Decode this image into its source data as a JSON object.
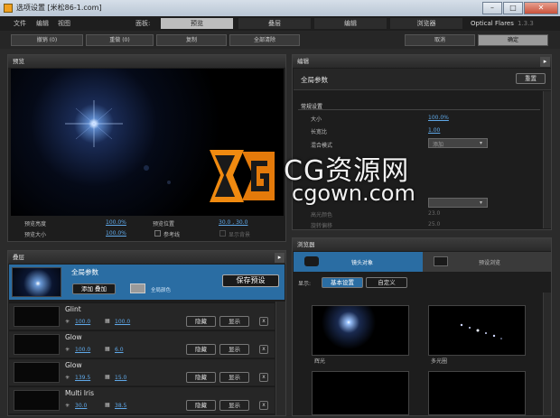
{
  "window": {
    "title": "选项设置 [米松86-1.com]",
    "minimize": "–",
    "maximize": "□",
    "close": "✕"
  },
  "menu": {
    "file": "文件",
    "edit": "编辑",
    "view": "视图",
    "panel_label": "面板:"
  },
  "panel_tabs": [
    {
      "label": "预览"
    },
    {
      "label": "叠层"
    },
    {
      "label": "编辑"
    },
    {
      "label": "浏览器"
    }
  ],
  "brand": {
    "name": "Optical Flares",
    "version": "1.3.3"
  },
  "toolbar": {
    "undo": "撤销 (0)",
    "redo": "重做 (0)",
    "copy": "复制",
    "clear_all": "全部清除",
    "cancel": "取消",
    "ok": "确定"
  },
  "preview": {
    "title": "预览",
    "brightness_label": "预览亮度",
    "brightness_value": "100.0%",
    "position_label": "预览位置",
    "position_value": "30.0 , 30.0",
    "size_label": "预览大小",
    "size_value": "100.0%",
    "reference_label": "参考线",
    "show_bg_label": "显示背景"
  },
  "layers": {
    "title": "叠层",
    "global": {
      "name": "全局参数",
      "add_label": "添加 叠加",
      "color_label": "全局颜色",
      "save_preset": "保存预设"
    },
    "items": [
      {
        "name": "Glint",
        "brightness": "100.0",
        "scale": "100.0",
        "hide": "隐藏",
        "show": "显示",
        "close": "x"
      },
      {
        "name": "Glow",
        "brightness": "100.0",
        "scale": "6.0",
        "hide": "隐藏",
        "show": "显示",
        "close": "x"
      },
      {
        "name": "Glow",
        "brightness": "139.5",
        "scale": "15.0",
        "hide": "隐藏",
        "show": "显示",
        "close": "x"
      },
      {
        "name": "Multi Iris",
        "brightness": "30.0",
        "scale": "38.5",
        "hide": "隐藏",
        "show": "显示",
        "close": "x"
      }
    ]
  },
  "editor": {
    "title": "编辑",
    "global_label": "全局参数",
    "reset": "重置",
    "section": "常规设置",
    "rows": [
      {
        "label": "大小",
        "value": "100.0%"
      },
      {
        "label": "长宽比",
        "value": "1.00"
      },
      {
        "label": "混合模式",
        "value": "添加"
      }
    ],
    "faded": [
      {
        "label": "高光颜色",
        "value": "23.0"
      },
      {
        "label": "旋转偏移",
        "value": "25.0"
      }
    ]
  },
  "browser": {
    "title": "浏览器",
    "tab_lens": "镜头对象",
    "tab_presets": "预设浏览",
    "show_label": "显示:",
    "filter_basic": "基本设置",
    "filter_custom": "自定义",
    "thumbs": [
      {
        "label": "辉光"
      },
      {
        "label": "多光圈"
      }
    ]
  },
  "watermark": {
    "line1": "CG资源网",
    "line2": "cgown.com"
  },
  "colors": {
    "accent": "#2a6da3",
    "value_blue": "#5fa8e8",
    "logo_orange": "#f08a10"
  }
}
